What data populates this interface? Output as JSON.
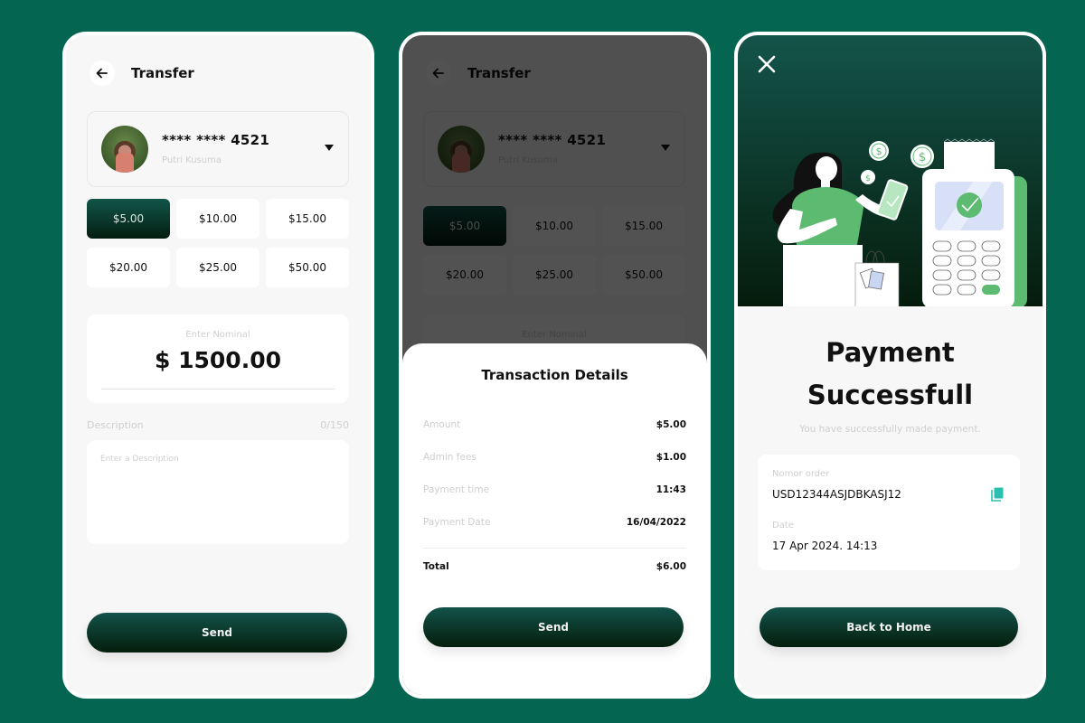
{
  "colors": {
    "background": "#046650",
    "accent_dark": "#041c10",
    "accent_light": "#12564a",
    "illustration_green": "#5cbb70",
    "copy_icon": "#2bbfb0"
  },
  "transfer": {
    "title": "Transfer",
    "back_icon": "arrow-left-icon",
    "account": {
      "number": "**** **** 4521",
      "name": "Putri Kusuma"
    },
    "amount_options": [
      "$5.00",
      "$10.00",
      "$15.00",
      "$20.00",
      "$25.00",
      "$50.00"
    ],
    "selected_amount": "$5.00",
    "nominal": {
      "label": "Enter Nominal",
      "value": "$ 1500.00"
    },
    "description": {
      "label": "Description",
      "counter": "0/150",
      "placeholder": "Enter a Description"
    },
    "send_label": "Send"
  },
  "transaction_details": {
    "title": "Transaction Details",
    "rows": [
      {
        "label": "Amount",
        "value": "$5.00"
      },
      {
        "label": "Admin fees",
        "value": "$1.00"
      },
      {
        "label": "Payment time",
        "value": "11:43"
      },
      {
        "label": "Payment Date",
        "value": "16/04/2022"
      }
    ],
    "total": {
      "label": "Total",
      "value": "$6.00"
    },
    "send_label": "Send"
  },
  "success": {
    "close_icon": "close-icon",
    "title_line1": "Payment",
    "title_line2": "Successfull",
    "subtitle": "You have successfully made payment.",
    "order_label": "Nomor order",
    "order_value": "USD12344ASJDBKASJ12",
    "date_label": "Date",
    "date_value": "17 Apr 2024. 14:13",
    "back_home_label": "Back to Home"
  }
}
